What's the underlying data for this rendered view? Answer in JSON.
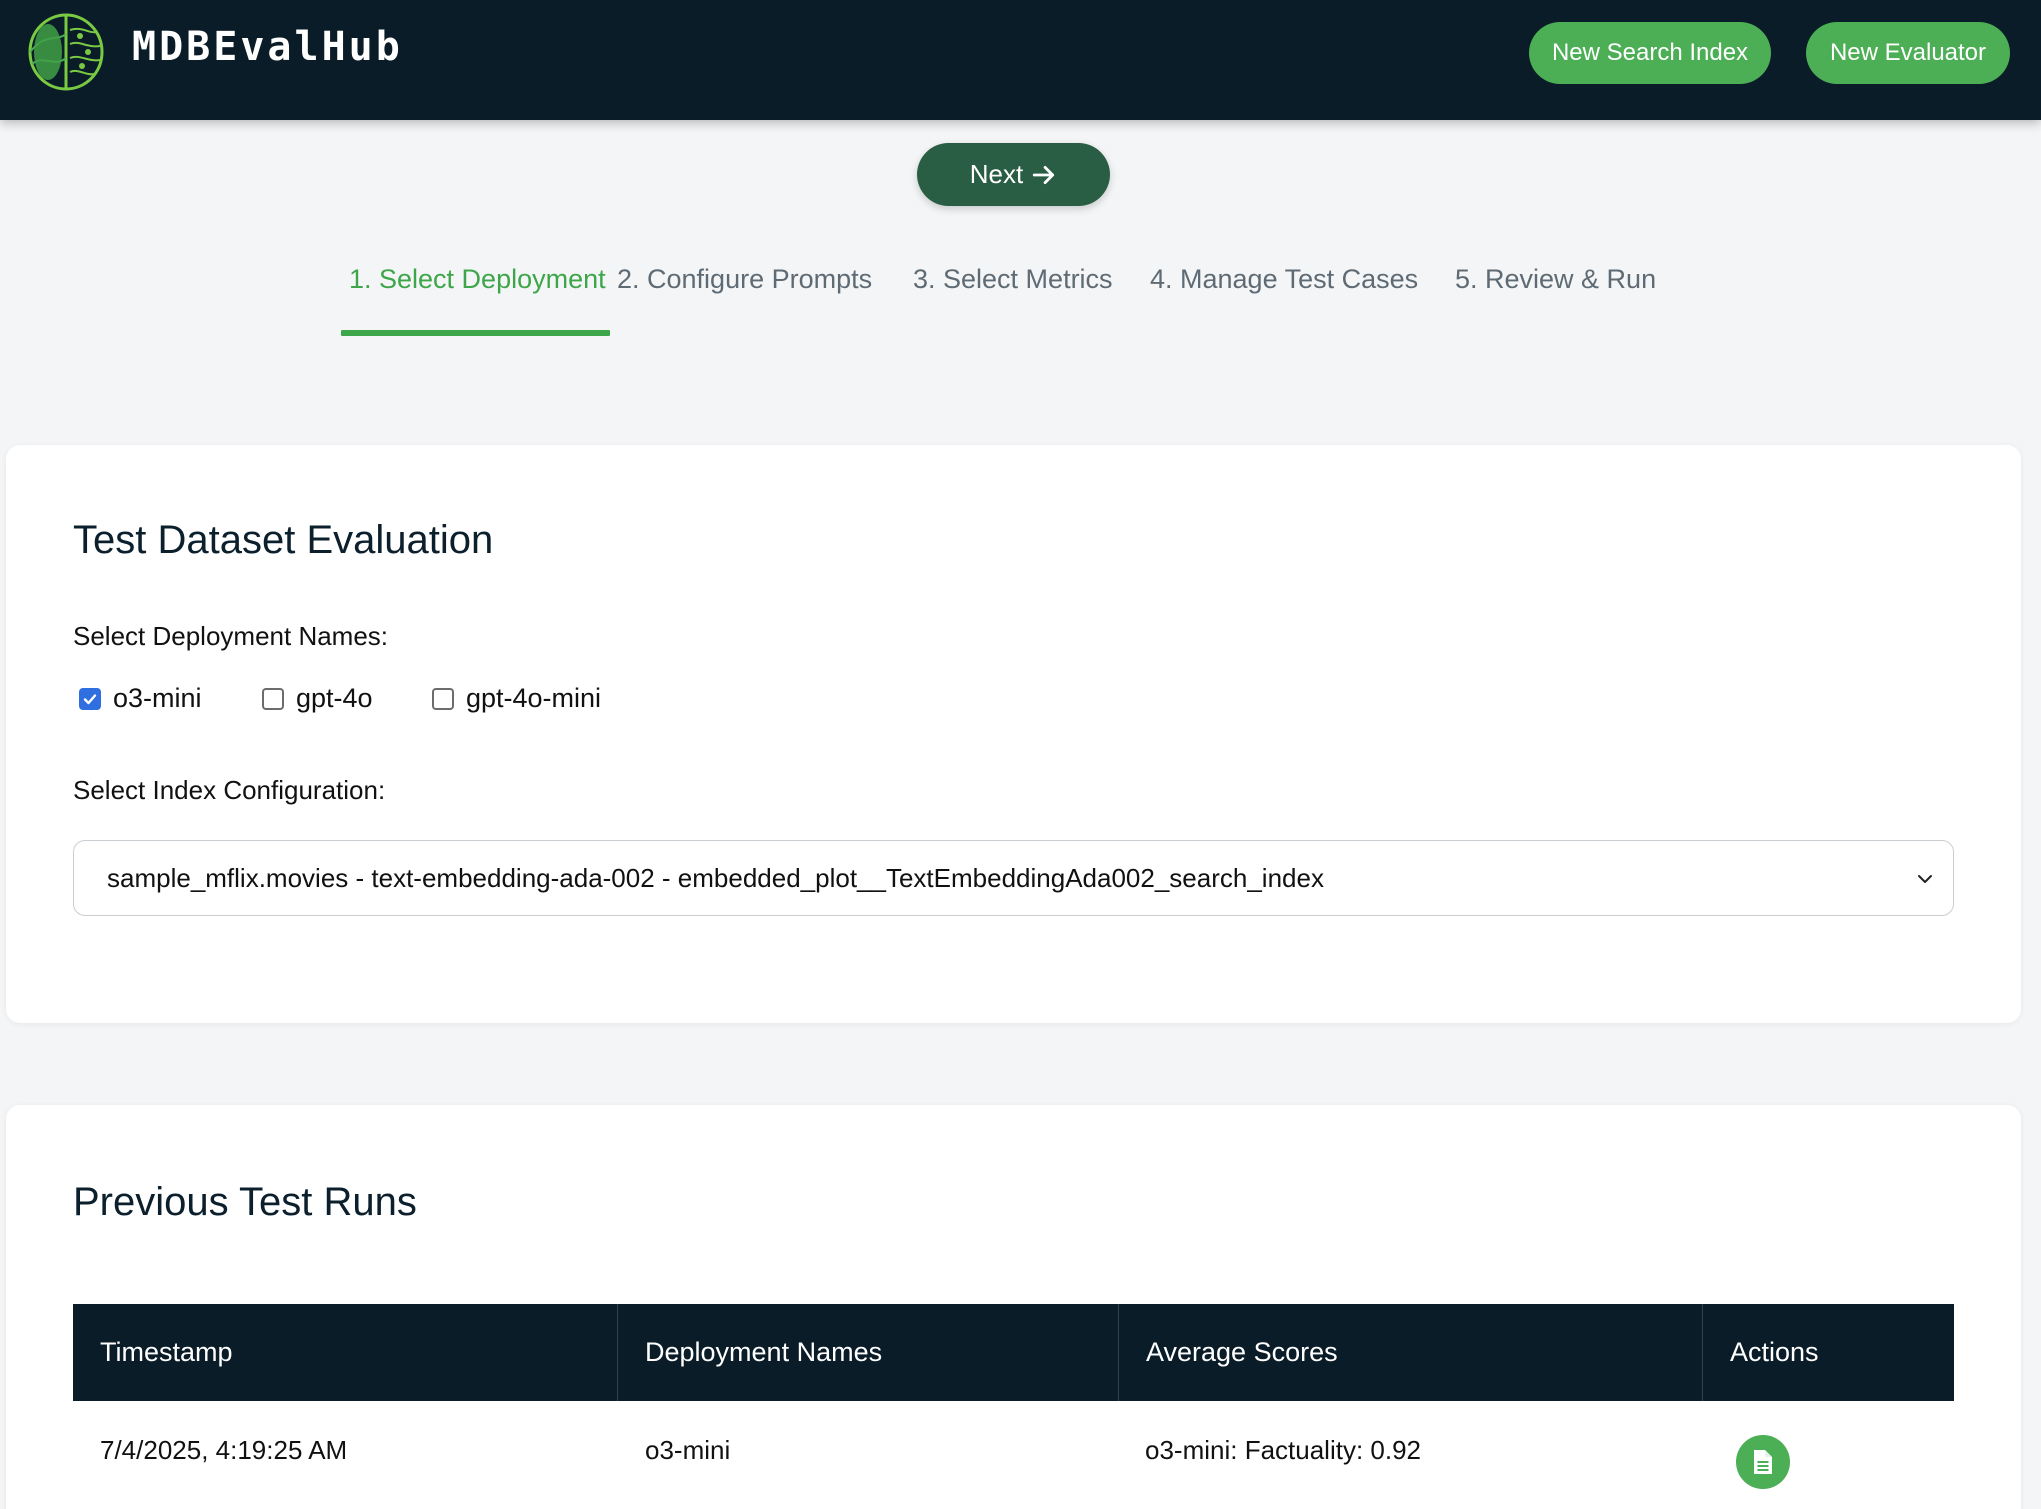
{
  "header": {
    "app_name": "MDBEvalHub",
    "logo_icon": "brain-icon",
    "new_search_index_label": "New Search Index",
    "new_evaluator_label": "New Evaluator"
  },
  "wizard": {
    "next_label": "Next",
    "steps": [
      {
        "label": "1. Select Deployment",
        "active": true
      },
      {
        "label": "2. Configure Prompts",
        "active": false
      },
      {
        "label": "3. Select Metrics",
        "active": false
      },
      {
        "label": "4. Manage Test Cases",
        "active": false
      },
      {
        "label": "5. Review & Run",
        "active": false
      }
    ]
  },
  "evaluation": {
    "title": "Test Dataset Evaluation",
    "deployments_label": "Select Deployment Names:",
    "deployments": [
      {
        "name": "o3-mini",
        "checked": true
      },
      {
        "name": "gpt-4o",
        "checked": false
      },
      {
        "name": "gpt-4o-mini",
        "checked": false
      }
    ],
    "index_label": "Select Index Configuration:",
    "index_selected": "sample_mflix.movies - text-embedding-ada-002 - embedded_plot__TextEmbeddingAda002_search_index"
  },
  "previous_runs": {
    "title": "Previous Test Runs",
    "columns": [
      "Timestamp",
      "Deployment Names",
      "Average Scores",
      "Actions"
    ],
    "rows": [
      {
        "timestamp": "7/4/2025, 4:19:25 AM",
        "deployments": "o3-mini",
        "scores": "o3-mini: Factuality: 0.92",
        "action_icon": "document-icon"
      }
    ]
  },
  "colors": {
    "header_bg": "#0a1c28",
    "accent_green": "#4cae55",
    "next_button": "#2a5e44",
    "active_step": "#3ea64a",
    "checkbox_checked": "#2f6fe0"
  }
}
